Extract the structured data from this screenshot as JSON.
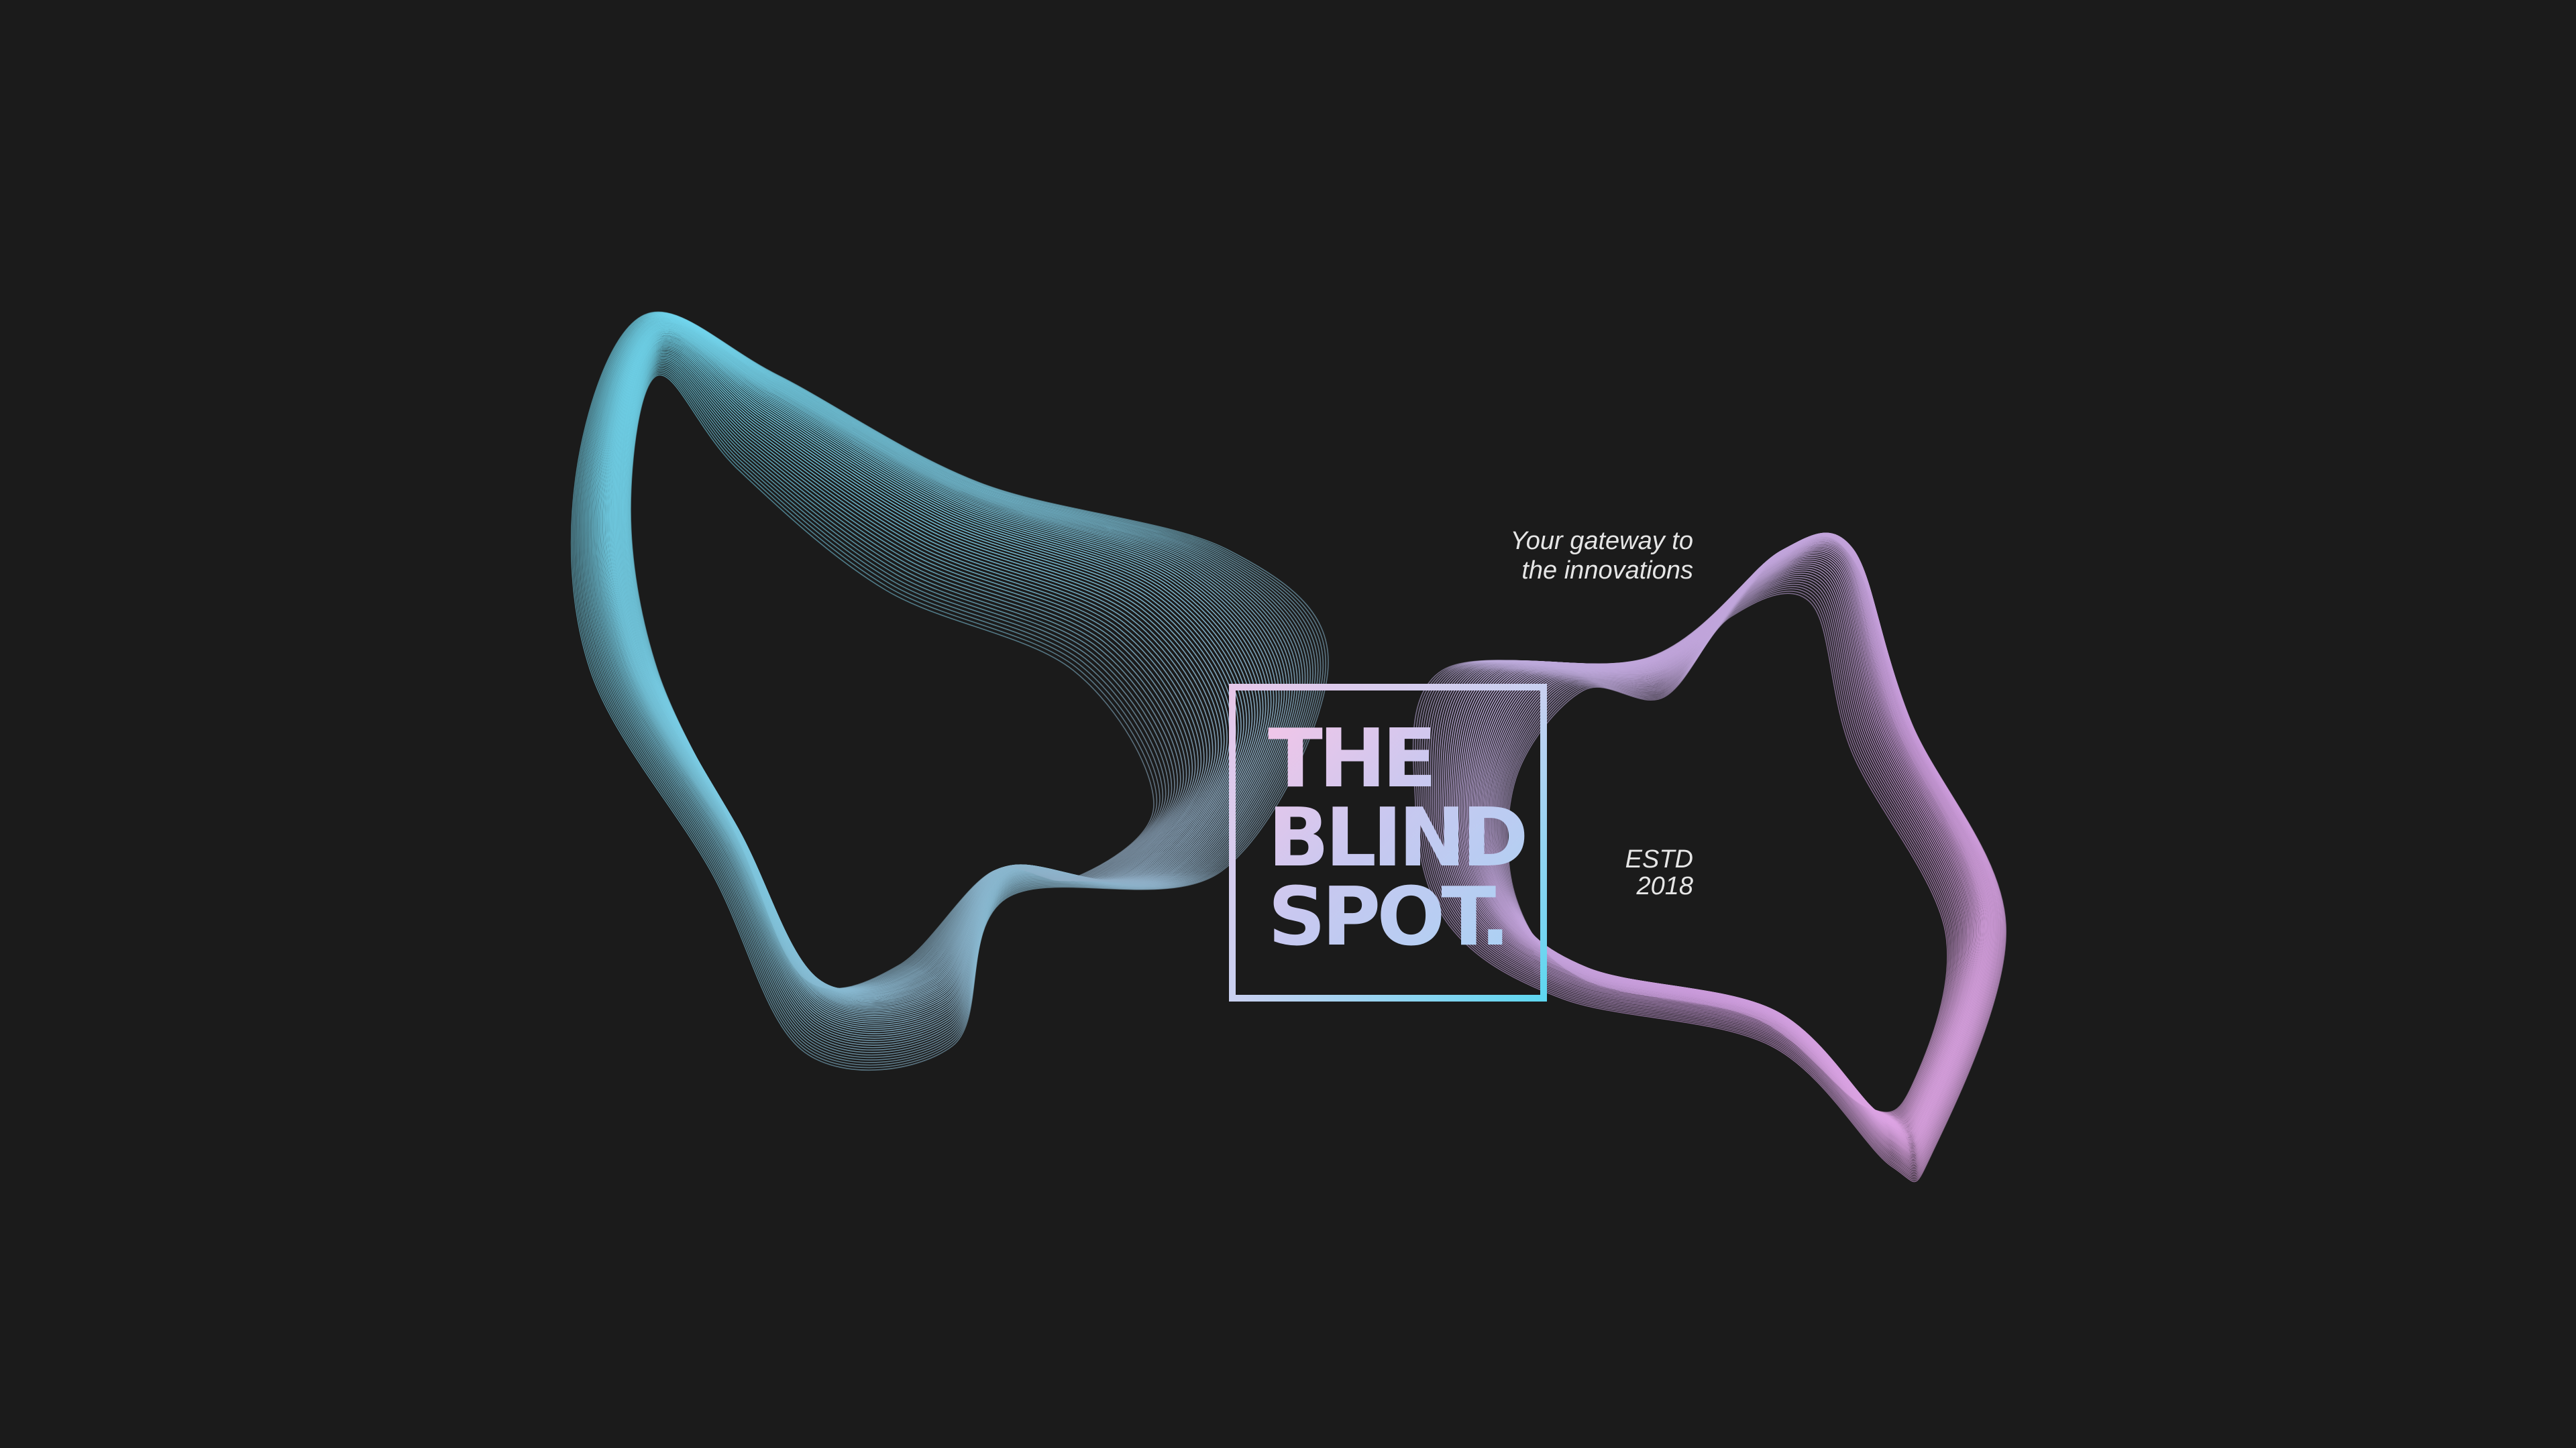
{
  "logo": {
    "lines": [
      "THE",
      "BLIND",
      "SPOT."
    ]
  },
  "tagline": {
    "line1": "Your gateway to",
    "line2": "the innovations"
  },
  "established": {
    "line1": "ESTD",
    "line2": "2018"
  },
  "colors": {
    "background": "#1b1b1b",
    "wave_left": "#5fd0ea",
    "wave_right": "#cf9bdf",
    "text": "#e6e6e6",
    "logo_gradient_start": "#f2c6e8",
    "logo_gradient_end": "#5fd6f0"
  },
  "decorations": {
    "left_wave": "mesh-wave-shape",
    "right_wave": "mesh-wave-shape"
  }
}
